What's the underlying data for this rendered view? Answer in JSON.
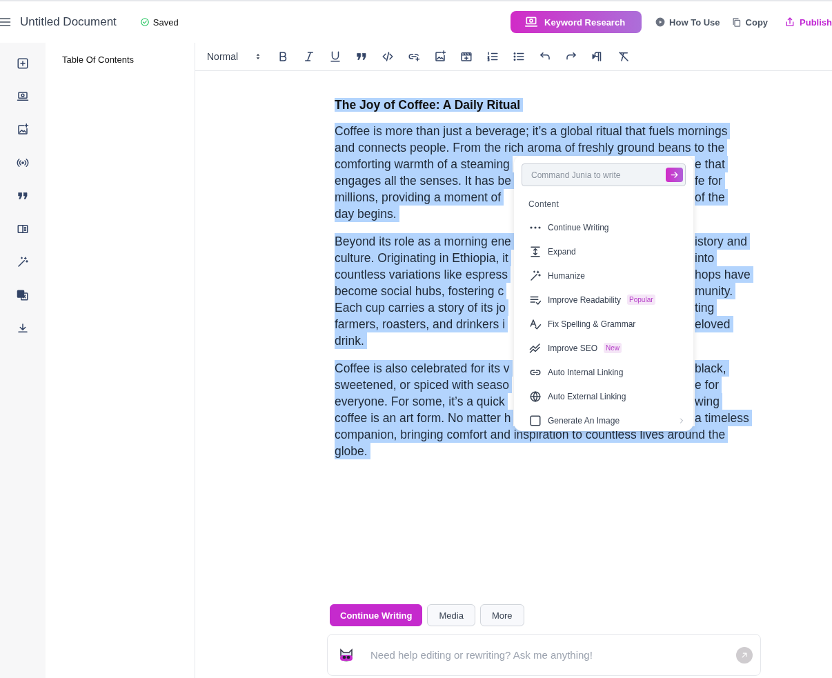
{
  "header": {
    "title": "Untitled Document",
    "status": "Saved",
    "actions": [
      {
        "label": "Keyword Research",
        "kind": "primary"
      },
      {
        "label": "How To Use",
        "kind": "play"
      },
      {
        "label": "Copy",
        "kind": "copy"
      },
      {
        "label": "Publish",
        "kind": "publish"
      }
    ]
  },
  "toc": {
    "title": "Table Of Contents"
  },
  "toolbar": {
    "style": "Normal"
  },
  "document": {
    "selected": true,
    "title": "The Joy of Coffee: A Daily Ritual",
    "paragraphs": [
      {
        "lines": [
          {
            "left": "Coffee is more than just a beverage; it’s a global ritual that fuels mornings"
          },
          {
            "left": "and connects people. From the rich aroma of freshly ground beans to the"
          },
          {
            "left": "comforting warmth of a steaming",
            "right": "e that"
          },
          {
            "left": "engages all the senses. It has be",
            "right": "fe for"
          },
          {
            "left": "millions, providing a moment of",
            "right": "of the"
          },
          {
            "left": "day begins."
          }
        ]
      },
      {
        "lines": [
          {
            "left": "Beyond its role as a morning ene",
            "right": "istory and"
          },
          {
            "left": "culture. Originating in Ethiopia, it",
            "right": "into"
          },
          {
            "left": "countless variations like espress",
            "right": "hops have"
          },
          {
            "left": "become social hubs, fostering c",
            "right": "munity."
          },
          {
            "left": "Each cup carries a story of its jo",
            "right": "ting"
          },
          {
            "left": "farmers, roasters, and drinkers i",
            "right": "eloved"
          },
          {
            "left": "drink."
          }
        ]
      },
      {
        "lines": [
          {
            "left": "Coffee is also celebrated for its v",
            "right": "black,"
          },
          {
            "left": "sweetened, or spiced with seaso",
            "right": "e for"
          },
          {
            "left": "everyone. For some, it’s a quick",
            "right": "wing"
          },
          {
            "left": "coffee is an art form. No matter h",
            "right": "a timeless"
          },
          {
            "left": "companion, bringing comfort and inspiration to countless lives around the"
          },
          {
            "left": "globe."
          }
        ]
      }
    ]
  },
  "command_menu": {
    "placeholder": "Command Junia to write",
    "section": "Content",
    "items": [
      {
        "label": "Continue Writing",
        "kind": "dots"
      },
      {
        "label": "Expand",
        "kind": "expand"
      },
      {
        "label": "Humanize",
        "kind": "wand"
      },
      {
        "label": "Improve Readability",
        "kind": "lines",
        "badge": "Popular"
      },
      {
        "label": "Fix Spelling & Grammar",
        "kind": "spell"
      },
      {
        "label": "Improve SEO",
        "kind": "trend",
        "badge": "New"
      },
      {
        "label": "Auto Internal Linking",
        "kind": "link"
      },
      {
        "label": "Auto External Linking",
        "kind": "globe"
      },
      {
        "label": "Generate An Image",
        "kind": "image",
        "submenu": true
      }
    ]
  },
  "quick_actions": [
    {
      "label": "Continue Writing",
      "kind": "primary"
    },
    {
      "label": "Media",
      "kind": "secondary"
    },
    {
      "label": "More",
      "kind": "secondary"
    }
  ],
  "chat": {
    "placeholder": "Need help editing or rewriting? Ask me anything!"
  }
}
